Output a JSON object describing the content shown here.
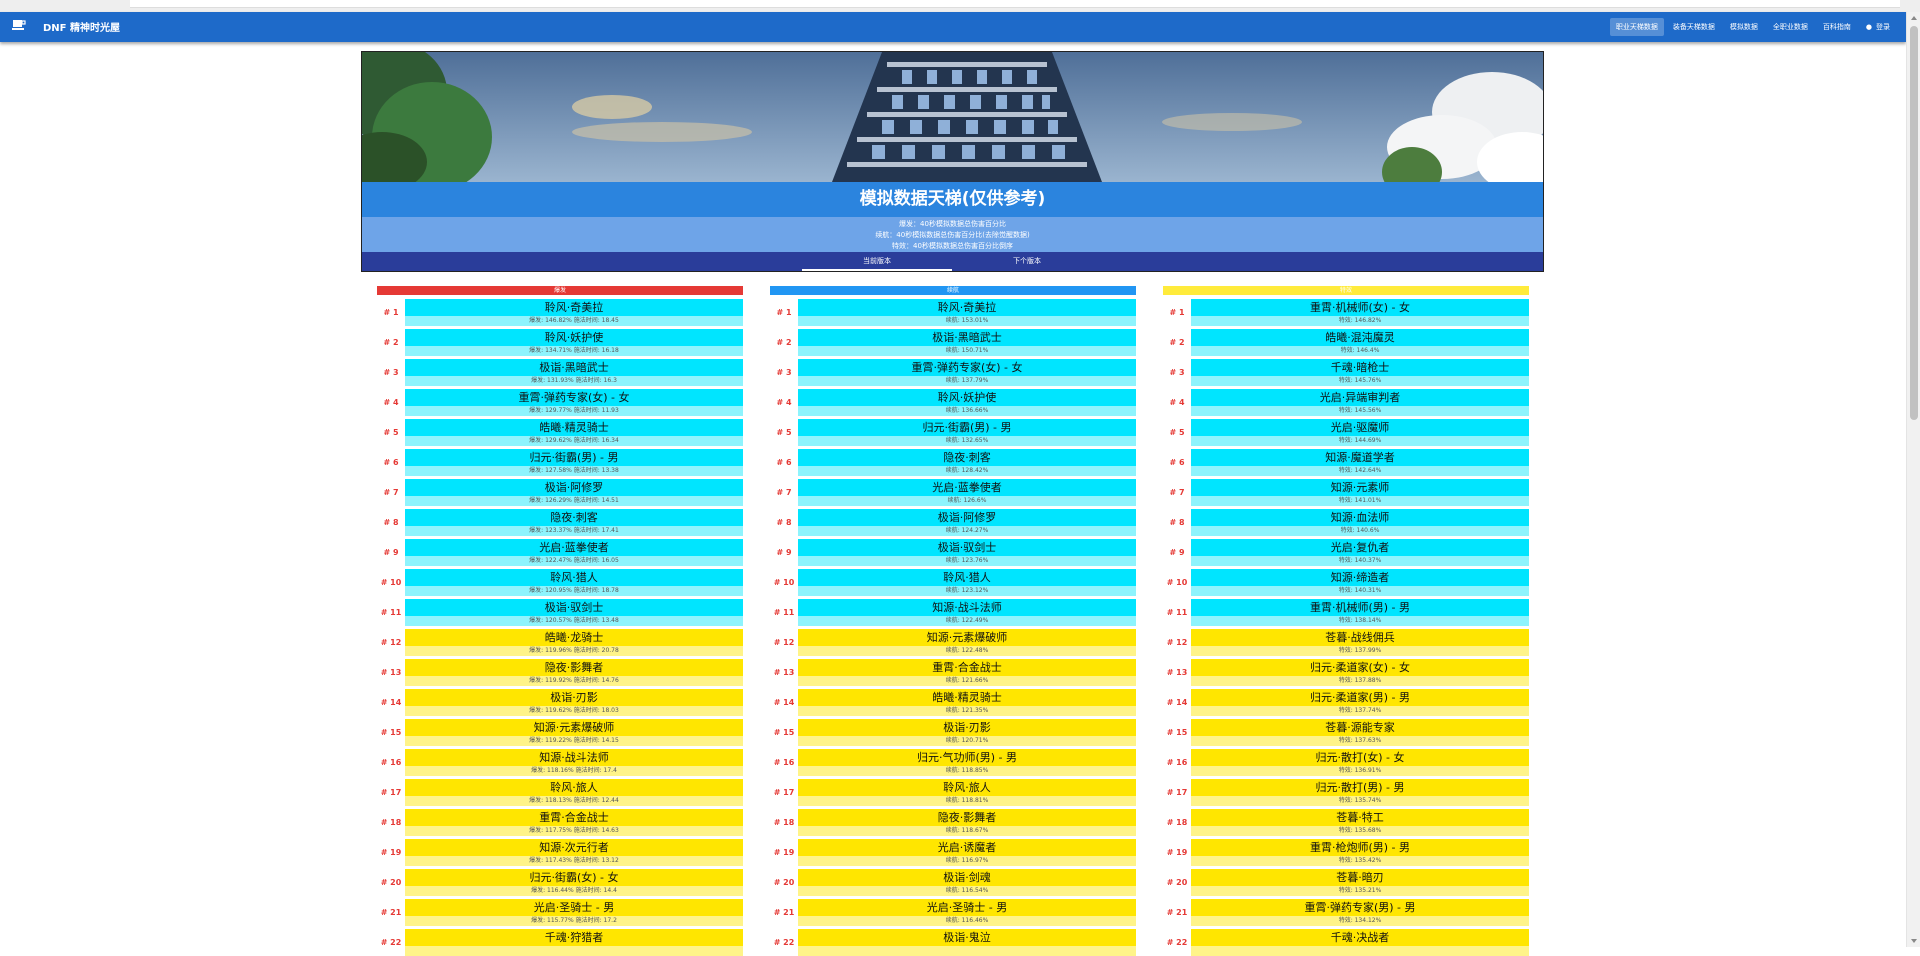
{
  "app": {
    "brand": "DNF 精神时光屋",
    "brand_icon": "coffee-cup-icon"
  },
  "nav": {
    "items": [
      "职业天梯数据",
      "装备天梯数据",
      "模拟数据",
      "全职业数据",
      "百科指南"
    ],
    "active_index": 0,
    "login": "登录",
    "login_icon": "user-icon"
  },
  "hero": {
    "title": "模拟数据天梯(仅供参考)",
    "notes": [
      "爆发：40秒模拟数据总伤害百分比",
      "续航：40秒模拟数据总伤害百分比(去除觉醒数据)",
      "特效：40秒模拟数据总伤害百分比倒序"
    ],
    "tabs": [
      "当前版本",
      "下个版本"
    ],
    "active_tab": 0
  },
  "colors": {
    "nav": "#1e6ac9",
    "tier_top": "#00e5ff",
    "tier_rest": "#ffe600",
    "rank": "#e53935",
    "burst_header": "#e53935",
    "sustain_header": "#2196f3",
    "effect_header": "#ffeb3b"
  },
  "columns": [
    {
      "title": "爆发",
      "color": "#e53935",
      "rows": [
        {
          "rank": "# 1",
          "name": "聆风·奇美拉",
          "stat": "爆发: 146.82% 施法时间: 18.45",
          "tier": "top"
        },
        {
          "rank": "# 2",
          "name": "聆风·妖护使",
          "stat": "爆发: 134.71% 施法时间: 16.18",
          "tier": "top"
        },
        {
          "rank": "# 3",
          "name": "极诣·黑暗武士",
          "stat": "爆发: 131.93% 施法时间: 16.3",
          "tier": "top"
        },
        {
          "rank": "# 4",
          "name": "重霄·弹药专家(女) - 女",
          "stat": "爆发: 129.77% 施法时间: 11.93",
          "tier": "top"
        },
        {
          "rank": "# 5",
          "name": "皓曦·精灵骑士",
          "stat": "爆发: 129.62% 施法时间: 16.34",
          "tier": "top"
        },
        {
          "rank": "# 6",
          "name": "归元·街霸(男) - 男",
          "stat": "爆发: 127.58% 施法时间: 13.38",
          "tier": "top"
        },
        {
          "rank": "# 7",
          "name": "极诣·阿修罗",
          "stat": "爆发: 126.29% 施法时间: 14.51",
          "tier": "top"
        },
        {
          "rank": "# 8",
          "name": "隐夜·刺客",
          "stat": "爆发: 123.37% 施法时间: 17.41",
          "tier": "top"
        },
        {
          "rank": "# 9",
          "name": "光启·蓝拳使者",
          "stat": "爆发: 122.47% 施法时间: 16.05",
          "tier": "top"
        },
        {
          "rank": "# 10",
          "name": "聆风·猎人",
          "stat": "爆发: 120.95% 施法时间: 18.78",
          "tier": "top"
        },
        {
          "rank": "# 11",
          "name": "极诣·驭剑士",
          "stat": "爆发: 120.57% 施法时间: 13.48",
          "tier": "top"
        },
        {
          "rank": "# 12",
          "name": "皓曦·龙骑士",
          "stat": "爆发: 119.96% 施法时间: 20.78",
          "tier": "rest"
        },
        {
          "rank": "# 13",
          "name": "隐夜·影舞者",
          "stat": "爆发: 119.92% 施法时间: 14.76",
          "tier": "rest"
        },
        {
          "rank": "# 14",
          "name": "极诣·刃影",
          "stat": "爆发: 119.62% 施法时间: 18.03",
          "tier": "rest"
        },
        {
          "rank": "# 15",
          "name": "知源·元素爆破师",
          "stat": "爆发: 119.22% 施法时间: 14.15",
          "tier": "rest"
        },
        {
          "rank": "# 16",
          "name": "知源·战斗法师",
          "stat": "爆发: 118.16% 施法时间: 17.4",
          "tier": "rest"
        },
        {
          "rank": "# 17",
          "name": "聆风·旅人",
          "stat": "爆发: 118.13% 施法时间: 12.44",
          "tier": "rest"
        },
        {
          "rank": "# 18",
          "name": "重霄·合金战士",
          "stat": "爆发: 117.75% 施法时间: 14.63",
          "tier": "rest"
        },
        {
          "rank": "# 19",
          "name": "知源·次元行者",
          "stat": "爆发: 117.43% 施法时间: 13.12",
          "tier": "rest"
        },
        {
          "rank": "# 20",
          "name": "归元·街霸(女) - 女",
          "stat": "爆发: 116.44% 施法时间: 14.4",
          "tier": "rest"
        },
        {
          "rank": "# 21",
          "name": "光启·圣骑士 - 男",
          "stat": "爆发: 115.77% 施法时间: 17.2",
          "tier": "rest"
        },
        {
          "rank": "# 22",
          "name": "千魂·狩猎者",
          "stat": "",
          "tier": "rest"
        }
      ]
    },
    {
      "title": "续航",
      "color": "#2196f3",
      "rows": [
        {
          "rank": "# 1",
          "name": "聆风·奇美拉",
          "stat": "续航: 153.01%",
          "tier": "top"
        },
        {
          "rank": "# 2",
          "name": "极诣·黑暗武士",
          "stat": "续航: 150.71%",
          "tier": "top"
        },
        {
          "rank": "# 3",
          "name": "重霄·弹药专家(女) - 女",
          "stat": "续航: 137.79%",
          "tier": "top"
        },
        {
          "rank": "# 4",
          "name": "聆风·妖护使",
          "stat": "续航: 136.66%",
          "tier": "top"
        },
        {
          "rank": "# 5",
          "name": "归元·街霸(男) - 男",
          "stat": "续航: 132.65%",
          "tier": "top"
        },
        {
          "rank": "# 6",
          "name": "隐夜·刺客",
          "stat": "续航: 128.42%",
          "tier": "top"
        },
        {
          "rank": "# 7",
          "name": "光启·蓝拳使者",
          "stat": "续航: 126.6%",
          "tier": "top"
        },
        {
          "rank": "# 8",
          "name": "极诣·阿修罗",
          "stat": "续航: 124.27%",
          "tier": "top"
        },
        {
          "rank": "# 9",
          "name": "极诣·驭剑士",
          "stat": "续航: 123.76%",
          "tier": "top"
        },
        {
          "rank": "# 10",
          "name": "聆风·猎人",
          "stat": "续航: 123.12%",
          "tier": "top"
        },
        {
          "rank": "# 11",
          "name": "知源·战斗法师",
          "stat": "续航: 122.49%",
          "tier": "top"
        },
        {
          "rank": "# 12",
          "name": "知源·元素爆破师",
          "stat": "续航: 122.48%",
          "tier": "rest"
        },
        {
          "rank": "# 13",
          "name": "重霄·合金战士",
          "stat": "续航: 121.66%",
          "tier": "rest"
        },
        {
          "rank": "# 14",
          "name": "皓曦·精灵骑士",
          "stat": "续航: 121.35%",
          "tier": "rest"
        },
        {
          "rank": "# 15",
          "name": "极诣·刃影",
          "stat": "续航: 120.71%",
          "tier": "rest"
        },
        {
          "rank": "# 16",
          "name": "归元·气功师(男) - 男",
          "stat": "续航: 118.85%",
          "tier": "rest"
        },
        {
          "rank": "# 17",
          "name": "聆风·旅人",
          "stat": "续航: 118.81%",
          "tier": "rest"
        },
        {
          "rank": "# 18",
          "name": "隐夜·影舞者",
          "stat": "续航: 118.67%",
          "tier": "rest"
        },
        {
          "rank": "# 19",
          "name": "光启·诱魔者",
          "stat": "续航: 116.97%",
          "tier": "rest"
        },
        {
          "rank": "# 20",
          "name": "极诣·剑魂",
          "stat": "续航: 116.54%",
          "tier": "rest"
        },
        {
          "rank": "# 21",
          "name": "光启·圣骑士 - 男",
          "stat": "续航: 116.46%",
          "tier": "rest"
        },
        {
          "rank": "# 22",
          "name": "极诣·鬼泣",
          "stat": "",
          "tier": "rest"
        }
      ]
    },
    {
      "title": "特效",
      "color": "#ffeb3b",
      "rows": [
        {
          "rank": "# 1",
          "name": "重霄·机械师(女) - 女",
          "stat": "特效: 146.82%",
          "tier": "top"
        },
        {
          "rank": "# 2",
          "name": "皓曦·混沌魔灵",
          "stat": "特效: 146.4%",
          "tier": "top"
        },
        {
          "rank": "# 3",
          "name": "千魂·暗枪士",
          "stat": "特效: 145.76%",
          "tier": "top"
        },
        {
          "rank": "# 4",
          "name": "光启·异端审判者",
          "stat": "特效: 145.56%",
          "tier": "top"
        },
        {
          "rank": "# 5",
          "name": "光启·驱魔师",
          "stat": "特效: 144.69%",
          "tier": "top"
        },
        {
          "rank": "# 6",
          "name": "知源·魔道学者",
          "stat": "特效: 142.64%",
          "tier": "top"
        },
        {
          "rank": "# 7",
          "name": "知源·元素师",
          "stat": "特效: 141.01%",
          "tier": "top"
        },
        {
          "rank": "# 8",
          "name": "知源·血法师",
          "stat": "特效: 140.6%",
          "tier": "top"
        },
        {
          "rank": "# 9",
          "name": "光启·复仇者",
          "stat": "特效: 140.37%",
          "tier": "top"
        },
        {
          "rank": "# 10",
          "name": "知源·缔造者",
          "stat": "特效: 140.31%",
          "tier": "top"
        },
        {
          "rank": "# 11",
          "name": "重霄·机械师(男) - 男",
          "stat": "特效: 138.14%",
          "tier": "top"
        },
        {
          "rank": "# 12",
          "name": "苍暮·战线佣兵",
          "stat": "特效: 137.99%",
          "tier": "rest"
        },
        {
          "rank": "# 13",
          "name": "归元·柔道家(女) - 女",
          "stat": "特效: 137.88%",
          "tier": "rest"
        },
        {
          "rank": "# 14",
          "name": "归元·柔道家(男) - 男",
          "stat": "特效: 137.74%",
          "tier": "rest"
        },
        {
          "rank": "# 15",
          "name": "苍暮·源能专家",
          "stat": "特效: 137.63%",
          "tier": "rest"
        },
        {
          "rank": "# 16",
          "name": "归元·散打(女) - 女",
          "stat": "特效: 136.91%",
          "tier": "rest"
        },
        {
          "rank": "# 17",
          "name": "归元·散打(男) - 男",
          "stat": "特效: 135.74%",
          "tier": "rest"
        },
        {
          "rank": "# 18",
          "name": "苍暮·特工",
          "stat": "特效: 135.68%",
          "tier": "rest"
        },
        {
          "rank": "# 19",
          "name": "重霄·枪炮师(男) - 男",
          "stat": "特效: 135.42%",
          "tier": "rest"
        },
        {
          "rank": "# 20",
          "name": "苍暮·暗刃",
          "stat": "特效: 135.21%",
          "tier": "rest"
        },
        {
          "rank": "# 21",
          "name": "重霄·弹药专家(男) - 男",
          "stat": "特效: 134.12%",
          "tier": "rest"
        },
        {
          "rank": "# 22",
          "name": "千魂·决战者",
          "stat": "",
          "tier": "rest"
        }
      ]
    }
  ]
}
